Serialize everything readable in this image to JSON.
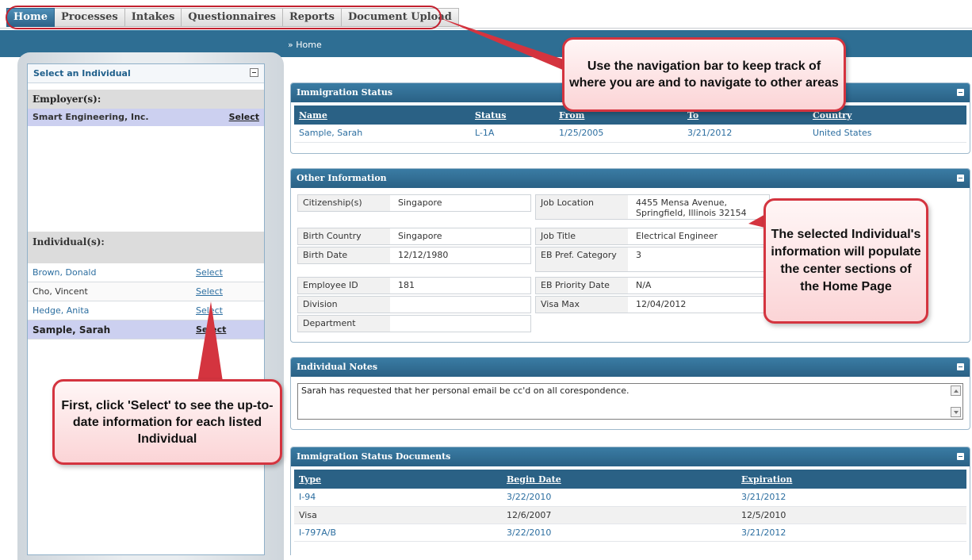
{
  "nav": {
    "tabs": [
      {
        "label": "Home",
        "active": true
      },
      {
        "label": "Processes",
        "active": false
      },
      {
        "label": "Intakes",
        "active": false
      },
      {
        "label": "Questionnaires",
        "active": false
      },
      {
        "label": "Reports",
        "active": false
      },
      {
        "label": "Document Upload",
        "active": false
      }
    ],
    "breadcrumb": "» Home"
  },
  "left_panel": {
    "title": "Select an Individual",
    "employers_title": "Employer(s):",
    "employer": {
      "name": "Smart Engineering, Inc.",
      "action": "Select"
    },
    "individuals_title": "Individual(s):",
    "individuals": [
      {
        "name": "Brown, Donald",
        "action": "Select",
        "selected": false
      },
      {
        "name": "Cho, Vincent",
        "action": "Select",
        "selected": false
      },
      {
        "name": "Hedge, Anita",
        "action": "Select",
        "selected": false
      },
      {
        "name": "Sample, Sarah",
        "action": "Select",
        "selected": true
      }
    ]
  },
  "immigration_status": {
    "title": "Immigration Status",
    "columns": [
      "Name",
      "Status",
      "From",
      "To",
      "Country"
    ],
    "rows": [
      [
        "Sample, Sarah",
        "L-1A",
        "1/25/2005",
        "3/21/2012",
        "United States"
      ]
    ]
  },
  "other_information": {
    "title": "Other Information",
    "citizenship_label": "Citizenship(s)",
    "citizenship": "Singapore",
    "birth_country_label": "Birth Country",
    "birth_country": "Singapore",
    "birth_date_label": "Birth Date",
    "birth_date": "12/12/1980",
    "employee_id_label": "Employee ID",
    "employee_id": "181",
    "division_label": "Division",
    "division": "",
    "department_label": "Department",
    "department": "",
    "job_location_label": "Job Location",
    "job_location": "4455 Mensa Avenue, Springfield, Illinois 32154",
    "job_title_label": "Job Title",
    "job_title": "Electrical Engineer",
    "eb_pref_label": "EB Pref. Category",
    "eb_pref": "3",
    "eb_priority_label": "EB Priority Date",
    "eb_priority": "N/A",
    "visa_max_label": "Visa Max",
    "visa_max": "12/04/2012"
  },
  "notes": {
    "title": "Individual Notes",
    "text": "Sarah has requested that her personal email be cc'd on all corespondence."
  },
  "documents": {
    "title": "Immigration Status Documents",
    "columns": [
      "Type",
      "Begin Date",
      "Expiration"
    ],
    "rows": [
      [
        "I-94",
        "3/22/2010",
        "3/21/2012"
      ],
      [
        "Visa",
        "12/6/2007",
        "12/5/2010"
      ],
      [
        "I-797A/B",
        "3/22/2010",
        "3/21/2012"
      ]
    ]
  },
  "callouts": {
    "nav": "Use the navigation bar to keep track of where you are and to navigate to other areas",
    "select": "First, click 'Select' to see the up-to-date information for each listed Individual",
    "populate": "The selected Individual's information will populate the center sections of the Home Page"
  },
  "colors": {
    "nav_active": "#2c6389",
    "band": "#2e6e93",
    "callout_border": "#d4343f",
    "selected_row": "#ccd0f0"
  }
}
